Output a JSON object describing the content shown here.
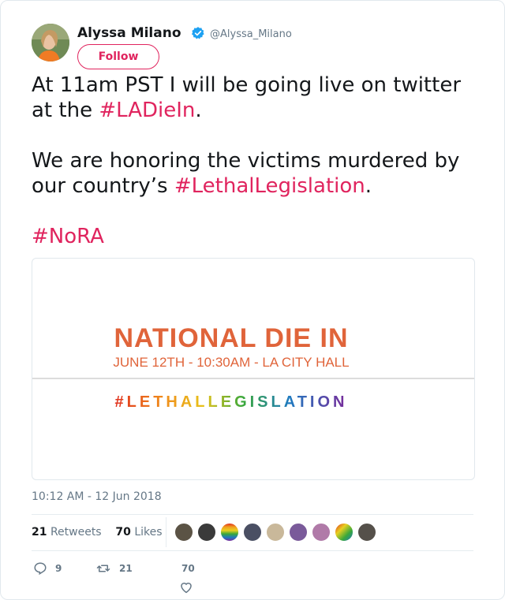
{
  "author": {
    "name": "Alyssa Milano",
    "handle": "@Alyssa_Milano",
    "verified_icon": "verified-badge-icon",
    "follow_label": "Follow"
  },
  "tweet": {
    "line1_prefix": "At 11",
    "line1_mid": "am PST I will be going live on twitter at the ",
    "hashtag1": "#LADieIn",
    "line1_end": ".",
    "line2_prefix": "We are honoring the victims murdered by our country’s ",
    "hashtag2": "#LethalLegislation",
    "line2_end": ".",
    "hashtag3": "#NoRA"
  },
  "card": {
    "title": "NATIONAL DIE IN",
    "subtitle": "JUNE 12TH - 10:30AM - LA CITY HALL",
    "hashtag": "#LETHALLEGISLATION",
    "title_color": "#e0643a",
    "subtitle_color": "#e0643a"
  },
  "timestamp": "10:12 AM - 12 Jun 2018",
  "stats": {
    "retweets_count": "21",
    "retweets_label": "Retweets",
    "likes_count": "70",
    "likes_label": "Likes"
  },
  "actions": {
    "reply_count": "9",
    "retweet_count": "21",
    "like_count": "70"
  },
  "colors": {
    "accent": "#e0245e",
    "muted": "#657786",
    "verified": "#1da1f2"
  }
}
